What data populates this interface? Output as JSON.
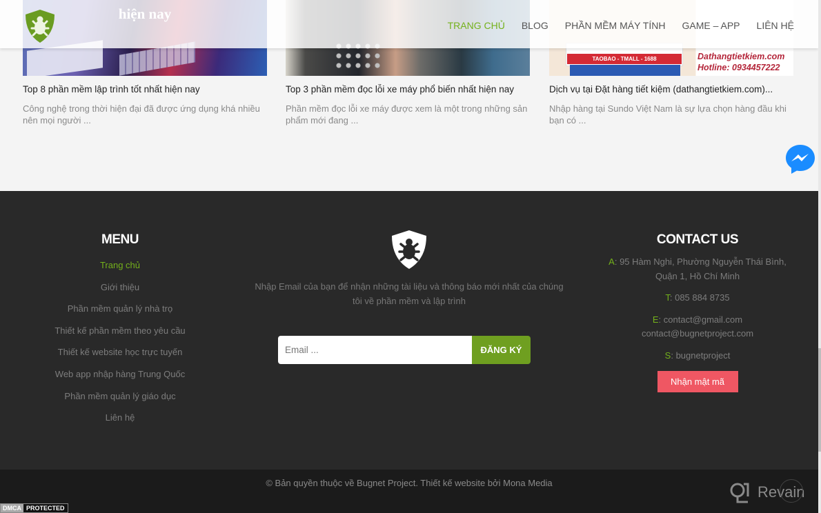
{
  "header": {
    "logo": "bug-shield-logo",
    "nav": [
      {
        "label": "TRANG CHỦ",
        "active": true
      },
      {
        "label": "BLOG",
        "active": false
      },
      {
        "label": "PHẦN MỀM MÁY TÍNH",
        "active": false
      },
      {
        "label": "GAME – APP",
        "active": false
      },
      {
        "label": "LIÊN HỆ",
        "active": false
      }
    ]
  },
  "posts": [
    {
      "thumb_caption": "hiện nay",
      "title": "Top 8 phần mềm lập trình tốt nhất hiện nay",
      "excerpt": "Công nghệ trong thời hiện đại đã được ứng dụng khá nhiều nên mọi người ..."
    },
    {
      "thumb_caption": "",
      "title": "Top 3 phần mềm đọc lỗi xe máy phổ biến nhất hiện nay",
      "excerpt": "Phần mềm đọc lỗi xe máy được xem là một trong những sản phẩm mới đang ..."
    },
    {
      "thumb_band": "TAOBAO - TMALL - 1688",
      "thumb_brand": "Dathangtietkiem.com",
      "thumb_hotline": "Hotline: 0934457222",
      "title": "Dịch vụ tại Đặt hàng tiết kiệm (dathangtietkiem.com)...",
      "excerpt": "Nhập hàng tại Sundo Việt Nam là sự lựa chọn hàng đầu khi bạn có ..."
    }
  ],
  "footer": {
    "menu": {
      "heading": "MENU",
      "items": [
        {
          "label": "Trang chủ",
          "active": true
        },
        {
          "label": "Giới thiệu"
        },
        {
          "label": "Phần mềm quản lý nhà trọ"
        },
        {
          "label": "Thiết kế phần mềm theo yêu cầu"
        },
        {
          "label": "Thiết kế website học trực tuyến"
        },
        {
          "label": "Web app nhập hàng Trung Quốc"
        },
        {
          "label": "Phần mềm quản lý giáo dục"
        },
        {
          "label": "Liên hệ"
        }
      ]
    },
    "newsletter": {
      "text": "Nhập Email của bạn để nhận những tài liệu và thông báo mới nhất của chúng tôi về phần mềm và lập trình",
      "email_placeholder": "Email ...",
      "email_value": "",
      "submit_label": "ĐĂNG KÝ"
    },
    "contact": {
      "heading": "CONTACT US",
      "address_key": "A",
      "address": "95 Hàm Nghi, Phường Nguyễn Thái Bình, Quận 1, Hồ Chí Minh",
      "phone_key": "T",
      "phone": "085 884 8735",
      "email_key": "E",
      "email1": "contact@gmail.com",
      "email2": "contact@bugnetproject.com",
      "skype_key": "S",
      "skype": "bugnetproject",
      "button_label": "Nhận mật mã"
    },
    "copyright": "© Bản quyền thuộc về Bugnet Project. Thiết kế website bởi Mona Media"
  },
  "badges": {
    "dmca_left": "DMCA",
    "dmca_right": "PROTECTED",
    "revain": "Revain"
  },
  "colors": {
    "accent_green": "#74b11b",
    "button_green": "#6f9f20",
    "password_button": "#ef5763",
    "footer_bg": "#292929",
    "copyright_bg": "#1b1b1b",
    "messenger_blue": "#1a8cff"
  }
}
